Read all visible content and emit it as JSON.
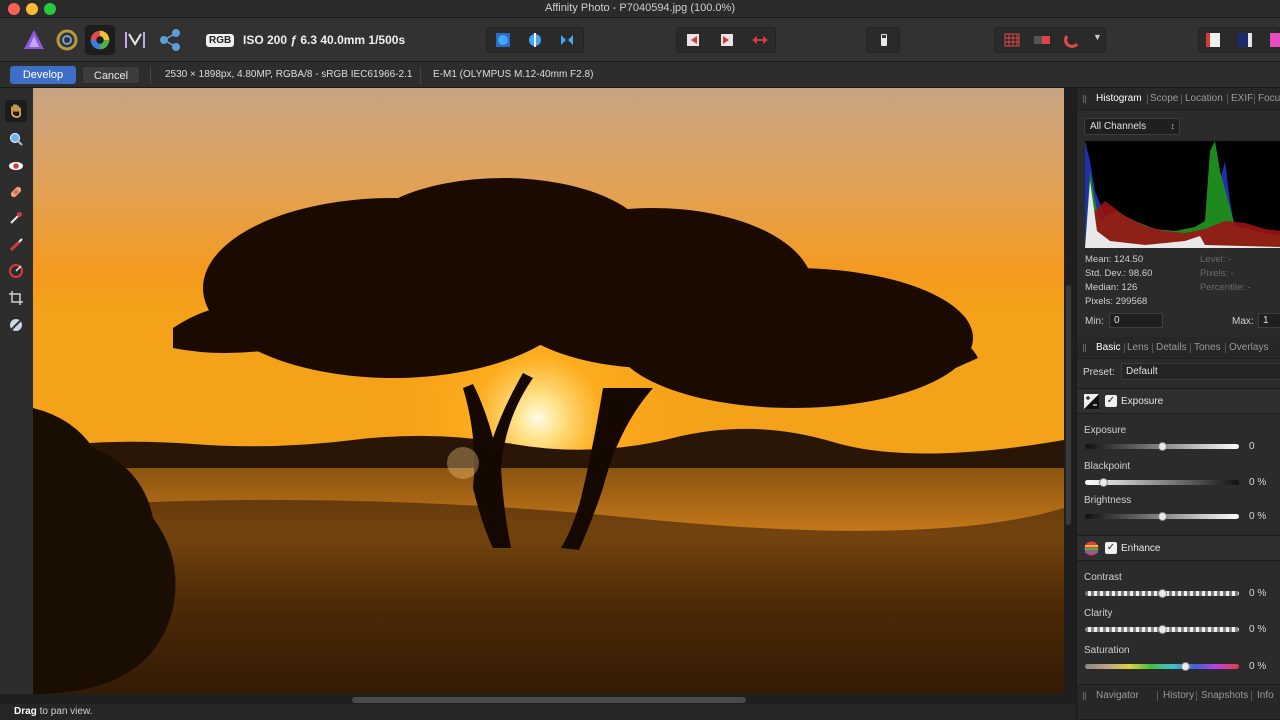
{
  "window": {
    "title": "Affinity Photo - P7040594.jpg (100.0%)"
  },
  "toolbar": {
    "personas": [
      "photo-persona",
      "liquify-persona",
      "develop-persona",
      "tone-mapping-persona",
      "export-persona"
    ],
    "color_mode": "RGB",
    "exif_summary": "ISO 200 ƒ 6.3 40.0mm 1/500s"
  },
  "context": {
    "develop_label": "Develop",
    "cancel_label": "Cancel",
    "image_info": "2530 × 1898px, 4.80MP, RGBA/8 - sRGB IEC61966-2.1",
    "camera_info": "E-M1 (OLYMPUS M.12-40mm F2.8)"
  },
  "status": {
    "bold": "Drag",
    "text": " to pan view."
  },
  "histogram_panel": {
    "tabs": [
      "Histogram",
      "Scope",
      "Location",
      "EXIF",
      "Focu"
    ],
    "channel": "All Channels",
    "stats_left": [
      "Mean: 124.50",
      "Std. Dev.: 98.60",
      "Median: 126",
      "Pixels: 299568"
    ],
    "stats_right": [
      "Level: -",
      "Pixels: -",
      "Percentile: -"
    ],
    "min_label": "Min:",
    "min_value": "0",
    "max_label": "Max:",
    "max_value": "1"
  },
  "develop_panel": {
    "tabs": [
      "Basic",
      "Lens",
      "Details",
      "Tones",
      "Overlays"
    ],
    "preset_label": "Preset:",
    "preset_value": "Default",
    "exposure_group": {
      "title": "Exposure",
      "sliders": [
        {
          "label": "Exposure",
          "value": "0",
          "position": 0.5
        },
        {
          "label": "Blackpoint",
          "value": "0 %",
          "position": 0.12
        },
        {
          "label": "Brightness",
          "value": "0 %",
          "position": 0.5
        }
      ]
    },
    "enhance_group": {
      "title": "Enhance",
      "sliders": [
        {
          "label": "Contrast",
          "value": "0 %",
          "position": 0.5
        },
        {
          "label": "Clarity",
          "value": "0 %",
          "position": 0.5
        },
        {
          "label": "Saturation",
          "value": "0 %",
          "position": 0.65
        }
      ]
    }
  },
  "bottom_tabs": [
    "Navigator",
    "History",
    "Snapshots",
    "Info"
  ],
  "colors": {
    "accent": "#3f6ec6",
    "panel": "#2b2b2b",
    "sun": "#ffd24a"
  }
}
